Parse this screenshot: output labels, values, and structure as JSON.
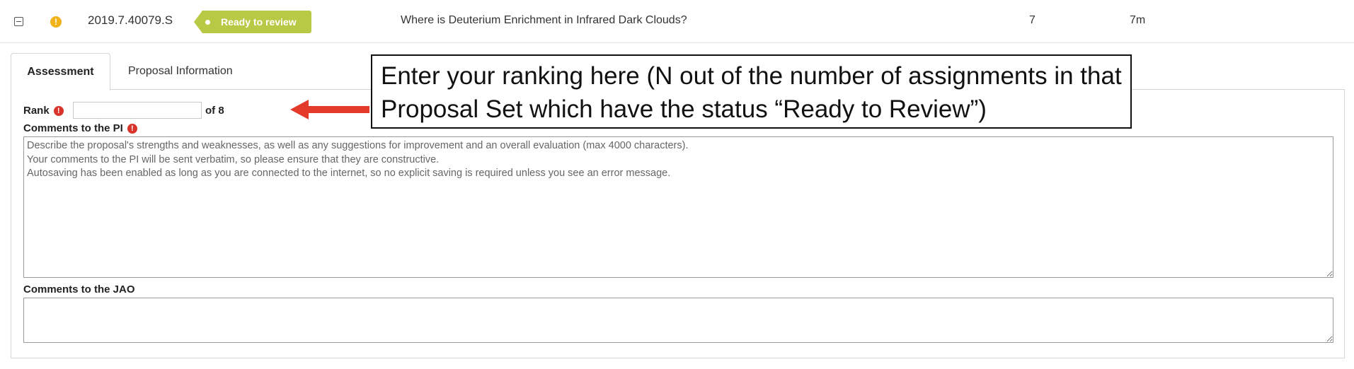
{
  "row": {
    "proposal_id": "2019.7.40079.S",
    "status": "Ready to review",
    "title": "Where is Deuterium Enrichment in Infrared Dark Clouds?",
    "count": "7",
    "time": "7m",
    "status_color": "#b8c945",
    "warning_color": "#f2b21a"
  },
  "icons": {
    "collapse": "collapse-icon",
    "warning": "warning-icon",
    "required": "required-icon",
    "arrow": "arrow-icon"
  },
  "tabs": [
    {
      "label": "Assessment",
      "active": true
    },
    {
      "label": "Proposal Information",
      "active": false
    }
  ],
  "form": {
    "rank_label": "Rank",
    "rank_value": "",
    "rank_suffix": "of 8",
    "pi_comments_label": "Comments to the PI",
    "pi_comments_placeholder": "Describe the proposal's strengths and weaknesses, as well as any suggestions for improvement and an overall evaluation (max 4000 characters).\nYour comments to the PI will be sent verbatim, so please ensure that they are constructive.\nAutosaving has been enabled as long as you are connected to the internet, so no explicit saving is required unless you see an error message.",
    "jao_comments_label": "Comments to the JAO",
    "jao_comments_placeholder": "",
    "required_color": "#d9342b"
  },
  "annotation": {
    "text": "Enter your ranking here (N out of the number of assignments in that Proposal Set which have the status “Ready to Review”)",
    "arrow_color": "#e43a2b"
  }
}
